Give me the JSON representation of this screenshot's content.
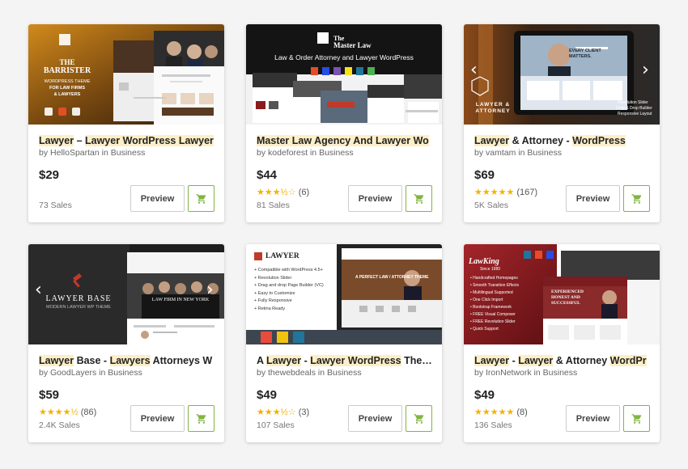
{
  "colors": {
    "accent_green": "#82b541",
    "star": "#f3b203",
    "highlight": "#fcefc6"
  },
  "icons": {
    "cart": "shopping-cart-icon",
    "prev": "chevron-left-icon",
    "next": "chevron-right-icon"
  },
  "items": [
    {
      "title_parts": [
        "Lawyer",
        " – ",
        "Lawyer",
        " ",
        "WordPress",
        " ",
        "Lawyer"
      ],
      "author": "HelloSpartan",
      "category": "Business",
      "price": "$29",
      "rating_stars": "",
      "rating_count": "",
      "sales": "73 Sales",
      "preview_label": "Preview",
      "thumb": {
        "brand": "THE",
        "brand2": "BARRISTER",
        "tagline1": "WORDPRESS THEME",
        "tagline2": "FOR LAW FIRMS",
        "tagline3": "& LAWYERS"
      }
    },
    {
      "title_parts": [
        "Master Law Agency And Lawyer Wo"
      ],
      "author": "kodeforest",
      "category": "Business",
      "price": "$44",
      "rating_stars": "★★★½☆",
      "rating_count": "(6)",
      "sales": "81 Sales",
      "preview_label": "Preview",
      "thumb": {
        "brand": "The",
        "brand2": "Master Law",
        "tagline1": "Law & Order Attorney and Lawyer WordPress"
      }
    },
    {
      "title_parts": [
        "Lawyer",
        " & Attorney - ",
        "WordPress"
      ],
      "author": "vamtam",
      "category": "Business",
      "price": "$69",
      "rating_stars": "★★★★★",
      "rating_count": "(167)",
      "sales": "5K Sales",
      "preview_label": "Preview",
      "thumb": {
        "brand": "LAWYER &",
        "brand2": "ATTORNEY",
        "tagline1": "EVERY CLIENT",
        "tagline2": "MATTERS.",
        "tagline3": "Revolution Slider",
        "tagline4": "Drag & Drop Builder",
        "tagline5": "Responsive Layout"
      }
    },
    {
      "title_parts": [
        "Lawyer",
        " Base - ",
        "Lawyers",
        " Attorneys W"
      ],
      "author": "GoodLayers",
      "category": "Business",
      "price": "$59",
      "rating_stars": "★★★★½",
      "rating_count": "(86)",
      "sales": "2.4K Sales",
      "preview_label": "Preview",
      "thumb": {
        "brand": "LAWYER BASE",
        "brand2": "MODERN LAWYER WP THEME",
        "tagline1": "LAW FIRM IN NEW YORK"
      }
    },
    {
      "title_parts": [
        "A ",
        "Lawyer",
        " - ",
        "Lawyer",
        " ",
        "WordPress",
        " Theme"
      ],
      "author": "thewebdeals",
      "category": "Business",
      "price": "$49",
      "rating_stars": "★★★½☆",
      "rating_count": "(3)",
      "sales": "107 Sales",
      "preview_label": "Preview",
      "thumb": {
        "brand": "LAWYER",
        "features": [
          "Compatible with WordPress 4.5+",
          "Revolution Slider",
          "Drag and drop Page Builder (VC)",
          "Easy to Customize",
          "Fully Responsive",
          "Retina Ready"
        ],
        "tagline1": "A PERFECT LAW / ATTORNEY THEME"
      }
    },
    {
      "title_parts": [
        "Lawyer",
        " - ",
        "Lawyer",
        " & Attorney ",
        "WordPr"
      ],
      "author": "IronNetwork",
      "category": "Business",
      "price": "$49",
      "rating_stars": "★★★★★",
      "rating_count": "(8)",
      "sales": "136 Sales",
      "preview_label": "Preview",
      "thumb": {
        "brand": "LawKing",
        "brand2": "Since 1980",
        "features": [
          "Handcrafted Homepages",
          "Smooth Transition Effects",
          "Multilingual Supported",
          "One Click Import",
          "Bootstrap Framework",
          "FREE Visual Composer",
          "FREE Revolution Slider",
          "Quick Support"
        ],
        "tagline1": "EXPERIENCED",
        "tagline2": "HONEST AND",
        "tagline3": "SUCCESSFUL"
      }
    }
  ],
  "by_word": "by",
  "in_word": "in"
}
